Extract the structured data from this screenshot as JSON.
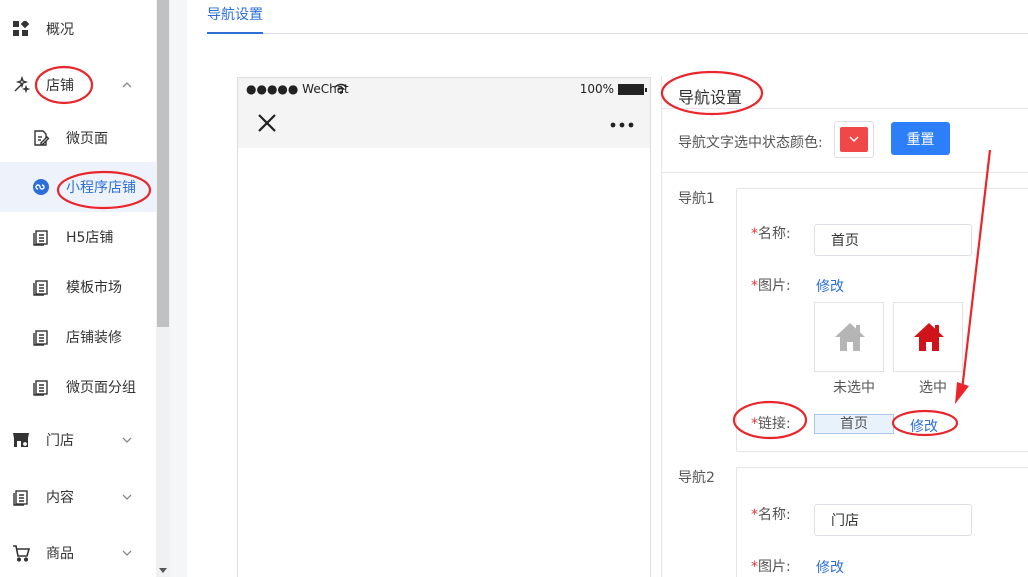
{
  "sidebar": {
    "items": [
      {
        "label": "概况"
      },
      {
        "label": "店铺"
      },
      {
        "label": "门店"
      },
      {
        "label": "内容"
      },
      {
        "label": "商品"
      }
    ],
    "shop_sub": [
      {
        "label": "微页面"
      },
      {
        "label": "小程序店铺"
      },
      {
        "label": "H5店铺"
      },
      {
        "label": "模板市场"
      },
      {
        "label": "店铺装修"
      },
      {
        "label": "微页面分组"
      }
    ]
  },
  "tabs": {
    "active": "导航设置"
  },
  "phone": {
    "carrier": "●●●●● WeChat",
    "battery": "100%"
  },
  "panel": {
    "title": "导航设置",
    "color_label": "导航文字选中状态颜色:",
    "selected_color": "#f04848",
    "reset_label": "重置",
    "nav1": {
      "group_label": "导航1",
      "name_label": "名称:",
      "name_value": "首页",
      "image_label": "图片:",
      "image_modify": "修改",
      "unselected_caption": "未选中",
      "selected_caption": "选中",
      "link_label": "链接:",
      "link_value": "首页",
      "link_modify": "修改"
    },
    "nav2": {
      "group_label": "导航2",
      "name_label": "名称:",
      "name_value": "门店",
      "image_label": "图片:",
      "image_modify": "修改"
    },
    "required_mark": "*"
  },
  "colors": {
    "accent": "#2d6fd6",
    "button": "#2d7ff9",
    "annotation": "#e8262b",
    "home_unselected": "#b5b5b5",
    "home_selected": "#d0121b"
  }
}
